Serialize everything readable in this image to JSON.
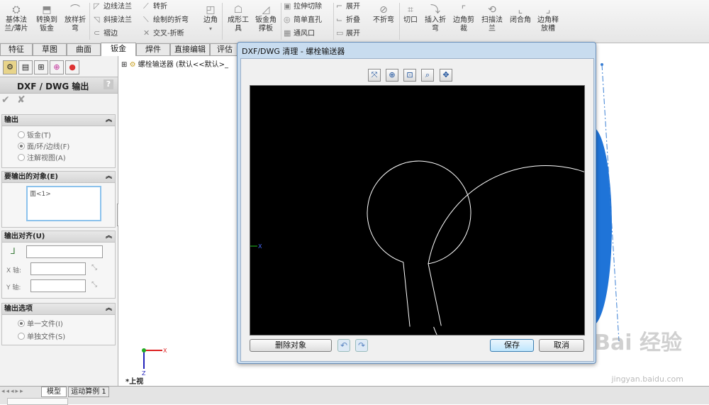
{
  "ribbon": {
    "big_buttons": [
      {
        "label": "基体法\n兰/薄片",
        "icon": "base-flange-icon"
      },
      {
        "label": "转换到\n钣金",
        "icon": "convert-sheetmetal-icon"
      },
      {
        "label": "放样折\n弯",
        "icon": "lofted-bend-icon"
      },
      {
        "label": "边角",
        "icon": "corners-icon"
      },
      {
        "label": "成形工\n具",
        "icon": "forming-tool-icon"
      },
      {
        "label": "钣金角\n撑板",
        "icon": "gusset-icon"
      },
      {
        "label": "不折弯",
        "icon": "no-bends-icon"
      },
      {
        "label": "切口",
        "icon": "rip-icon"
      },
      {
        "label": "插入折\n弯",
        "icon": "insert-bends-icon"
      },
      {
        "label": "边角剪\n裁",
        "icon": "corner-trim-icon"
      },
      {
        "label": "扫描法\n兰",
        "icon": "swept-flange-icon"
      },
      {
        "label": "闭合角",
        "icon": "closed-corner-icon"
      },
      {
        "label": "边角释\n放槽",
        "icon": "corner-relief-icon"
      }
    ],
    "small_buttons": [
      {
        "label": "边线法兰",
        "icon": "edge-flange-icon"
      },
      {
        "label": "斜接法兰",
        "icon": "miter-flange-icon"
      },
      {
        "label": "褶边",
        "icon": "hem-icon"
      },
      {
        "label": "转折",
        "icon": "jog-icon"
      },
      {
        "label": "绘制的折弯",
        "icon": "sketched-bend-icon"
      },
      {
        "label": "交叉-折断",
        "icon": "cross-break-icon"
      },
      {
        "label": "拉伸切除",
        "icon": "extruded-cut-icon"
      },
      {
        "label": "简单直孔",
        "icon": "simple-hole-icon"
      },
      {
        "label": "通风口",
        "icon": "vent-icon"
      },
      {
        "label": "展开",
        "icon": "unfold-icon"
      },
      {
        "label": "折叠",
        "icon": "fold-icon"
      },
      {
        "label": "展开",
        "icon": "flatten-icon"
      }
    ]
  },
  "tabs": [
    "特征",
    "草图",
    "曲面",
    "钣金",
    "焊件",
    "直接编辑",
    "评估"
  ],
  "active_tab": "钣金",
  "panel": {
    "title": "DXF / DWG 输出",
    "help": "?",
    "ok": "✔",
    "cancel": "✘",
    "output": {
      "header": "输出",
      "options": [
        "钣金(T)",
        "面/环/边线(F)",
        "注解视图(A)"
      ],
      "selected_index": 1
    },
    "entities": {
      "header": "要输出的对象(E)",
      "items": [
        "面<1>"
      ]
    },
    "alignment": {
      "header": "输出对齐(U)",
      "x_label": "X 轴:",
      "y_label": "Y 轴:"
    },
    "options": {
      "header": "输出选项",
      "choices": [
        "单一文件(I)",
        "单独文件(S)"
      ],
      "selected_index": 0
    }
  },
  "tree": {
    "item": "螺栓输送器 (默认<<默认>_"
  },
  "view": {
    "label": "*上视",
    "axis_x": "X",
    "axis_y": "Y",
    "axis_z": "Z"
  },
  "dialog": {
    "title": "DXF/DWG 清理 - 螺栓输送器",
    "toolbar": [
      "zoom-fit-icon",
      "zoom-in-icon",
      "zoom-area-icon",
      "zoom-window-icon",
      "pan-icon"
    ],
    "delete_label": "删除对象",
    "save_label": "保存",
    "cancel_label": "取消",
    "canvas_bg": "#000000",
    "stroke": "#ffffff"
  },
  "bottom": {
    "tabs": [
      "模型",
      "运动算例 1"
    ]
  },
  "watermark": {
    "brand": "Bai 经验",
    "url": "jingyan.baidu.com"
  },
  "accent": "#1f74d8"
}
